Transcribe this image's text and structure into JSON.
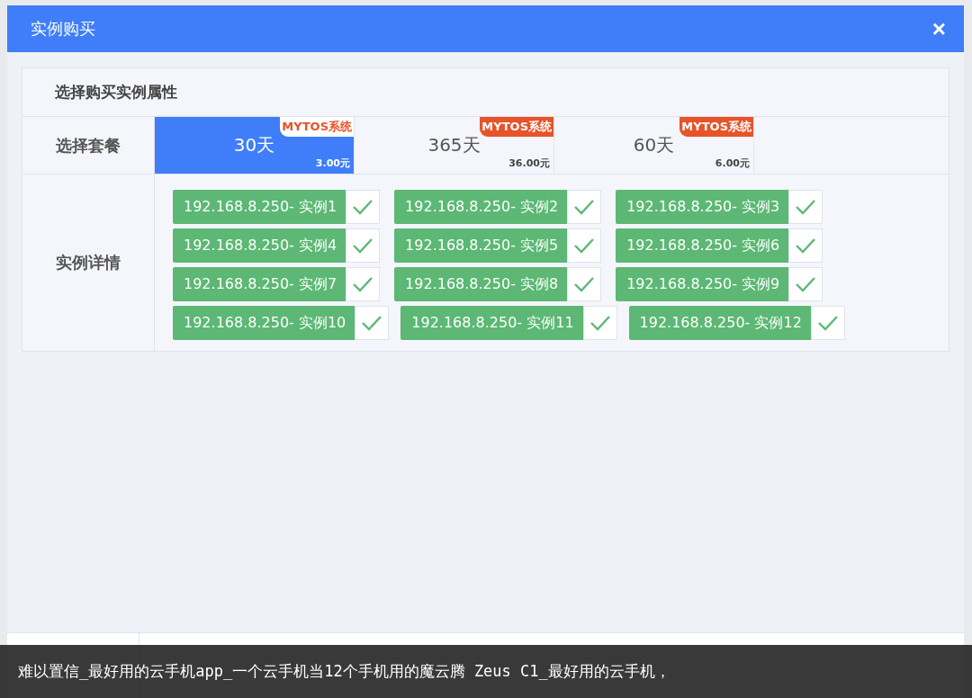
{
  "dialog": {
    "title": "实例购买",
    "close": "×"
  },
  "section_title": "选择购买实例属性",
  "package_row": {
    "label": "选择套餐",
    "packages": [
      {
        "name": "30天",
        "badge": "MYTOS系统",
        "price": "3.00元",
        "selected": true
      },
      {
        "name": "365天",
        "badge": "MYTOS系统",
        "price": "36.00元",
        "selected": false
      },
      {
        "name": "60天",
        "badge": "MYTOS系统",
        "price": "6.00元",
        "selected": false
      }
    ]
  },
  "instance_row": {
    "label": "实例详情",
    "instances": [
      {
        "name": "192.168.8.250- 实例1",
        "checked": true
      },
      {
        "name": "192.168.8.250- 实例2",
        "checked": true
      },
      {
        "name": "192.168.8.250- 实例3",
        "checked": true
      },
      {
        "name": "192.168.8.250- 实例4",
        "checked": true
      },
      {
        "name": "192.168.8.250- 实例5",
        "checked": true
      },
      {
        "name": "192.168.8.250- 实例6",
        "checked": true
      },
      {
        "name": "192.168.8.250- 实例7",
        "checked": true
      },
      {
        "name": "192.168.8.250- 实例8",
        "checked": true
      },
      {
        "name": "192.168.8.250- 实例9",
        "checked": true
      },
      {
        "name": "192.168.8.250- 实例10",
        "checked": true
      },
      {
        "name": "192.168.8.250- 实例11",
        "checked": true
      },
      {
        "name": "192.168.8.250- 实例12",
        "checked": true
      }
    ]
  },
  "caption": "难以置信_最好用的云手机app_一个云手机当12个手机用的魔云腾 Zeus C1_最好用的云手机，"
}
